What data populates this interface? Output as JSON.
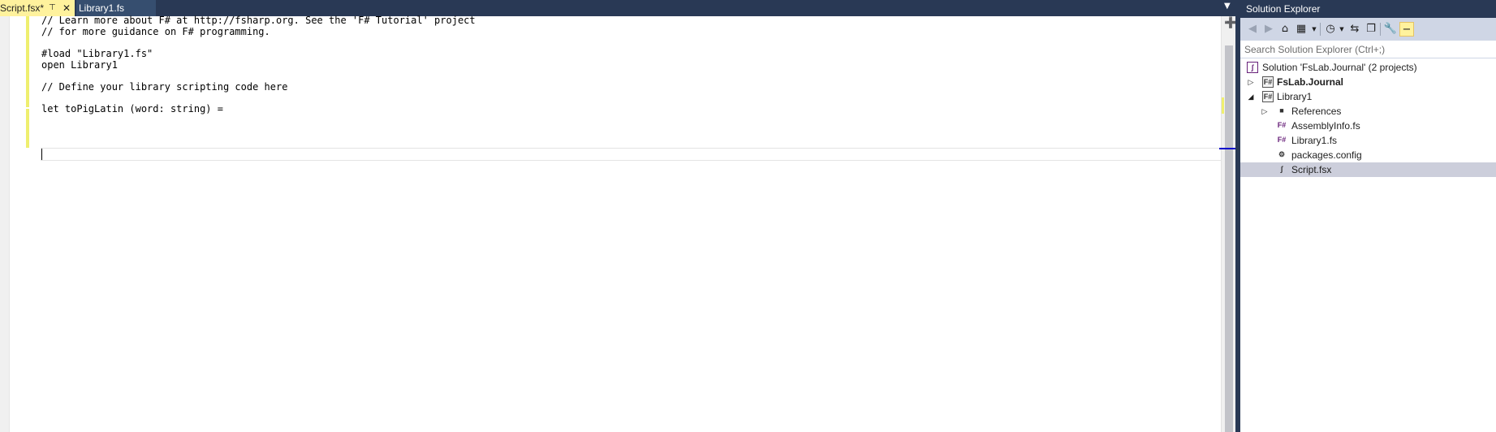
{
  "editor": {
    "tabs": [
      {
        "label": "Script.fsx*",
        "active": true
      },
      {
        "label": "Library1.fs",
        "active": false
      }
    ],
    "code_lines": [
      "// Learn more about F# at http://fsharp.org. See the 'F# Tutorial' project",
      "// for more guidance on F# programming.",
      "",
      "#load \"Library1.fs\"",
      "open Library1",
      "",
      "// Define your library scripting code here",
      "",
      "let toPigLatin (word: string) =",
      "",
      ""
    ]
  },
  "solution_explorer": {
    "title": "Solution Explorer",
    "search_placeholder": "Search Solution Explorer (Ctrl+;)",
    "toolbar_icons": [
      "back-icon",
      "forward-icon",
      "home-icon",
      "switch-views-icon",
      "dropdown-icon",
      "pending-changes-icon",
      "dropdown-icon",
      "sync-icon",
      "collapse-all-icon",
      "properties-icon",
      "preview-selected-icon"
    ],
    "tree": [
      {
        "label": "Solution 'FsLab.Journal' (2 projects)",
        "level": 0,
        "icon": "solution-icon",
        "expander": "none",
        "bold": false,
        "selected": false
      },
      {
        "label": "FsLab.Journal",
        "level": 0,
        "icon": "fsharp-project-icon",
        "expander": "collapsed",
        "bold": true,
        "selected": false
      },
      {
        "label": "Library1",
        "level": 0,
        "icon": "fsharp-project-icon",
        "expander": "expanded",
        "bold": false,
        "selected": false
      },
      {
        "label": "References",
        "level": 1,
        "icon": "references-icon",
        "expander": "collapsed",
        "bold": false,
        "selected": false
      },
      {
        "label": "AssemblyInfo.fs",
        "level": 1,
        "icon": "fsharp-file-icon",
        "expander": "none",
        "bold": false,
        "selected": false
      },
      {
        "label": "Library1.fs",
        "level": 1,
        "icon": "fsharp-file-icon",
        "expander": "none",
        "bold": false,
        "selected": false
      },
      {
        "label": "packages.config",
        "level": 1,
        "icon": "config-file-icon",
        "expander": "none",
        "bold": false,
        "selected": false
      },
      {
        "label": "Script.fsx",
        "level": 1,
        "icon": "fsharp-script-icon",
        "expander": "none",
        "bold": false,
        "selected": true
      }
    ]
  },
  "colors": {
    "chrome": "#293955",
    "active_tab": "#fff29d",
    "change_bar": "#efef6f",
    "selection": "#cccedb",
    "toolbar": "#cfd6e5"
  }
}
